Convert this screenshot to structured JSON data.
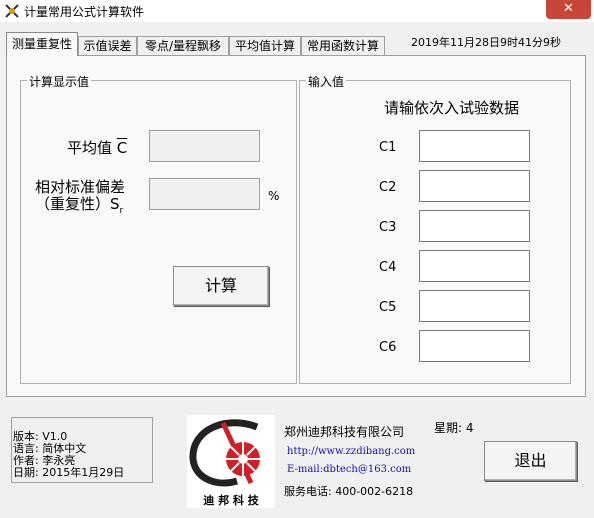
{
  "window": {
    "title": "计量常用公式计算软件",
    "close_label": "✕"
  },
  "tabs": [
    {
      "label": "测量重复性"
    },
    {
      "label": "示值误差"
    },
    {
      "label": "零点/量程飘移"
    },
    {
      "label": "平均值计算"
    },
    {
      "label": "常用函数计算"
    }
  ],
  "datetime": "2019年11月28日9时41分9秒",
  "display_group": {
    "title": "计算显示值",
    "mean_label": "平均值",
    "mean_symbol": "C",
    "rsd_label_line1": "相对标准偏差",
    "rsd_label_line2": "（重复性）S",
    "rsd_subscript": "r",
    "percent_unit": "%",
    "mean_value": "",
    "rsd_value": "",
    "calc_button": "计算"
  },
  "input_group": {
    "title": "输入值",
    "prompt": "请输依次入试验数据",
    "fields": [
      {
        "label": "C1",
        "value": ""
      },
      {
        "label": "C2",
        "value": ""
      },
      {
        "label": "C3",
        "value": ""
      },
      {
        "label": "C4",
        "value": ""
      },
      {
        "label": "C5",
        "value": ""
      },
      {
        "label": "C6",
        "value": ""
      }
    ]
  },
  "info": {
    "version": "版本: V1.0",
    "language": "语言: 简体中文",
    "author": "作者: 李永亮",
    "date": "日期: 2015年1月29日"
  },
  "company": {
    "logo_text": "迪 邦 科 技",
    "name": "郑州迪邦科技有限公司",
    "url": "http://www.zzdibang.com",
    "email": "E-mail:dbtech@163.com",
    "phone": "服务电话: 400-002-6218",
    "weekday": "星期:  4"
  },
  "exit_button": "退出",
  "colors": {
    "close": "#c7463a",
    "link": "#1010b0",
    "logo_red": "#d21f26"
  }
}
